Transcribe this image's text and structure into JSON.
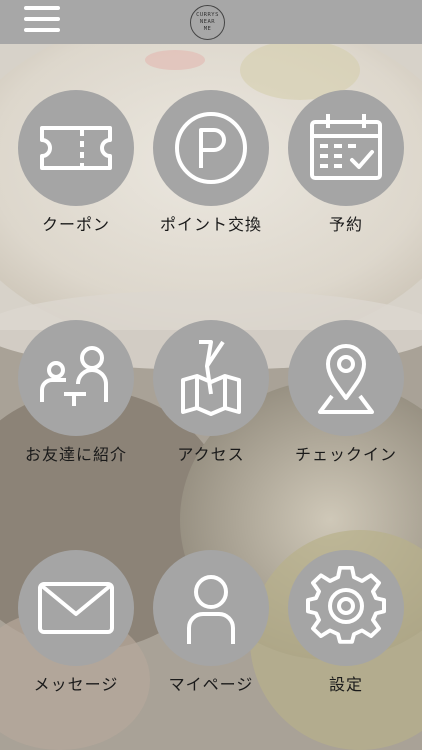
{
  "header": {
    "menu_icon": "hamburger-menu-icon",
    "logo_lines": [
      "CURRYS",
      "NEAR",
      "ME"
    ]
  },
  "menu": [
    {
      "label": "クーポン",
      "icon": "ticket-icon"
    },
    {
      "label": "ポイント交換",
      "icon": "parking-p-icon"
    },
    {
      "label": "予約",
      "icon": "calendar-icon"
    },
    {
      "label": "お友達に紹介",
      "icon": "people-icon"
    },
    {
      "label": "アクセス",
      "icon": "map-icon"
    },
    {
      "label": "チェックイン",
      "icon": "location-pin-icon"
    },
    {
      "label": "メッセージ",
      "icon": "envelope-icon"
    },
    {
      "label": "マイページ",
      "icon": "person-icon"
    },
    {
      "label": "設定",
      "icon": "gear-icon"
    }
  ],
  "colors": {
    "header": "#a7a7a7",
    "circle": "#a5a5a5",
    "icon": "#ffffff",
    "text": "#1a1a1a"
  }
}
